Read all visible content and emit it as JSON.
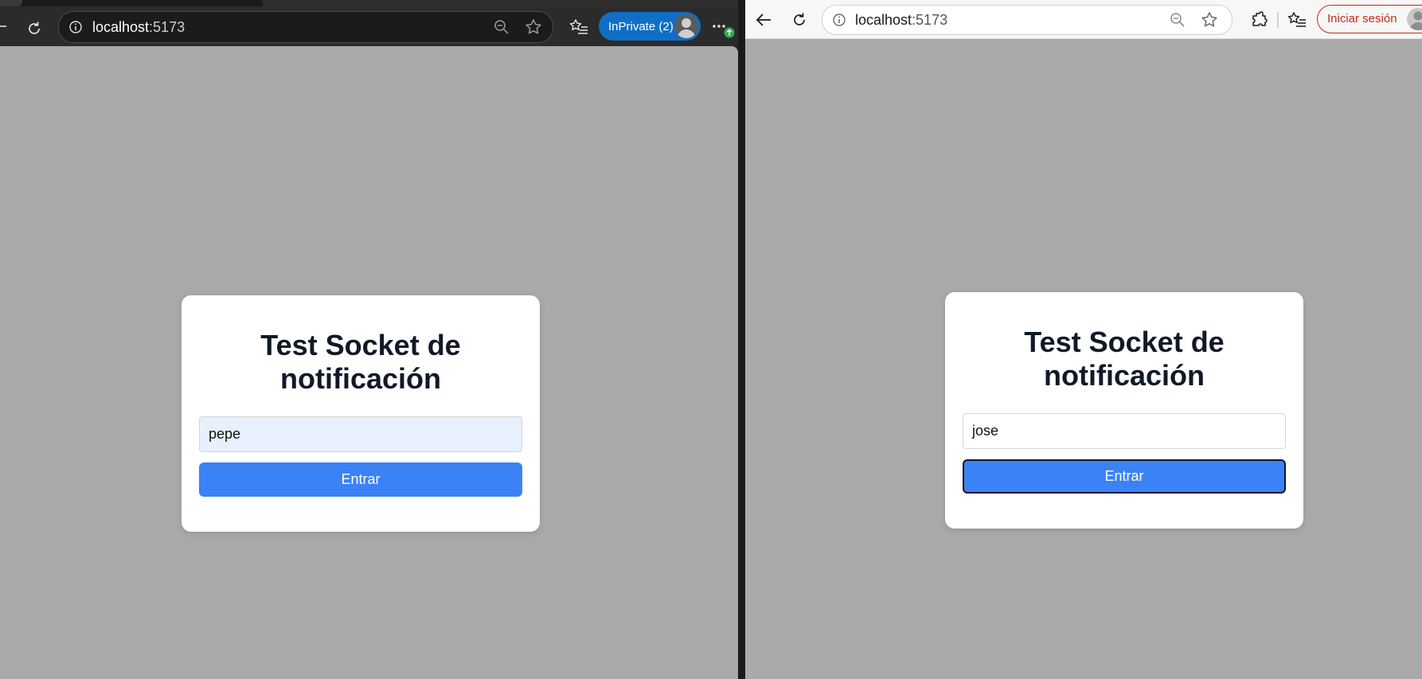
{
  "left_window": {
    "address": {
      "host": "localhost",
      "port": ":5173"
    },
    "profile_badge": "InPrivate (2)",
    "icons": [
      "refresh-icon",
      "site-info-icon",
      "zoom-out-icon",
      "favorite-star-icon",
      "favorites-icon",
      "more-icon"
    ]
  },
  "right_window": {
    "address": {
      "host": "localhost",
      "port": ":5173"
    },
    "signin_label": "Iniciar sesión",
    "icons": [
      "back-icon",
      "refresh-icon",
      "site-info-icon",
      "zoom-out-icon",
      "favorite-star-icon",
      "extensions-icon",
      "favorites-icon"
    ]
  },
  "left_app": {
    "title_line1": "Test Socket de",
    "title_line2": "notificación",
    "username_value": "pepe",
    "submit_label": "Entrar"
  },
  "right_app": {
    "title_line1": "Test Socket de",
    "title_line2": "notificación",
    "username_value": "jose",
    "submit_label": "Entrar"
  },
  "colors": {
    "page_background": "#a9a9a9",
    "card_background": "#ffffff",
    "button_primary": "#3b82f6",
    "autofill_field": "#e8f0fe",
    "inprivate_badge": "#0f6fc6",
    "signin_border": "#c42b1c"
  }
}
